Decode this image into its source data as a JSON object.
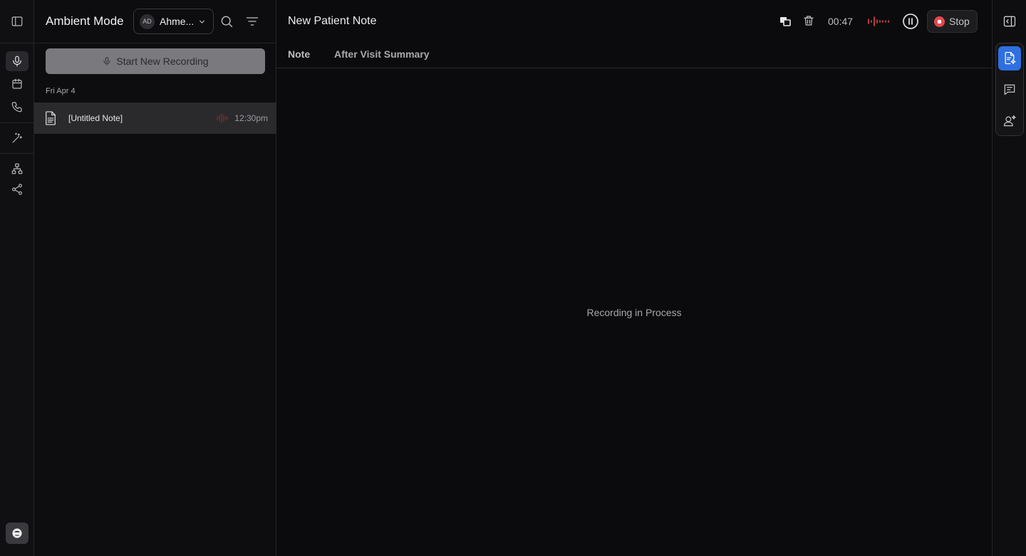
{
  "rail": {
    "items": [
      "sidebar-toggle",
      "microphone",
      "calendar",
      "phone",
      "magic-wand",
      "hierarchy",
      "share"
    ]
  },
  "list": {
    "title": "Ambient Mode",
    "user": {
      "initials": "AD",
      "name": "Ahme..."
    },
    "start_button": "Start New Recording",
    "date_group": "Fri Apr 4",
    "notes": [
      {
        "title": "[Untitled Note]",
        "time": "12:30pm"
      }
    ]
  },
  "main": {
    "title": "New Patient Note",
    "timer": "00:47",
    "stop_label": "Stop",
    "tabs": [
      "Note",
      "After Visit Summary"
    ],
    "empty_message": "Recording in Process"
  },
  "colors": {
    "accent": "#2f6fe0",
    "recording_red": "#e5484d"
  }
}
